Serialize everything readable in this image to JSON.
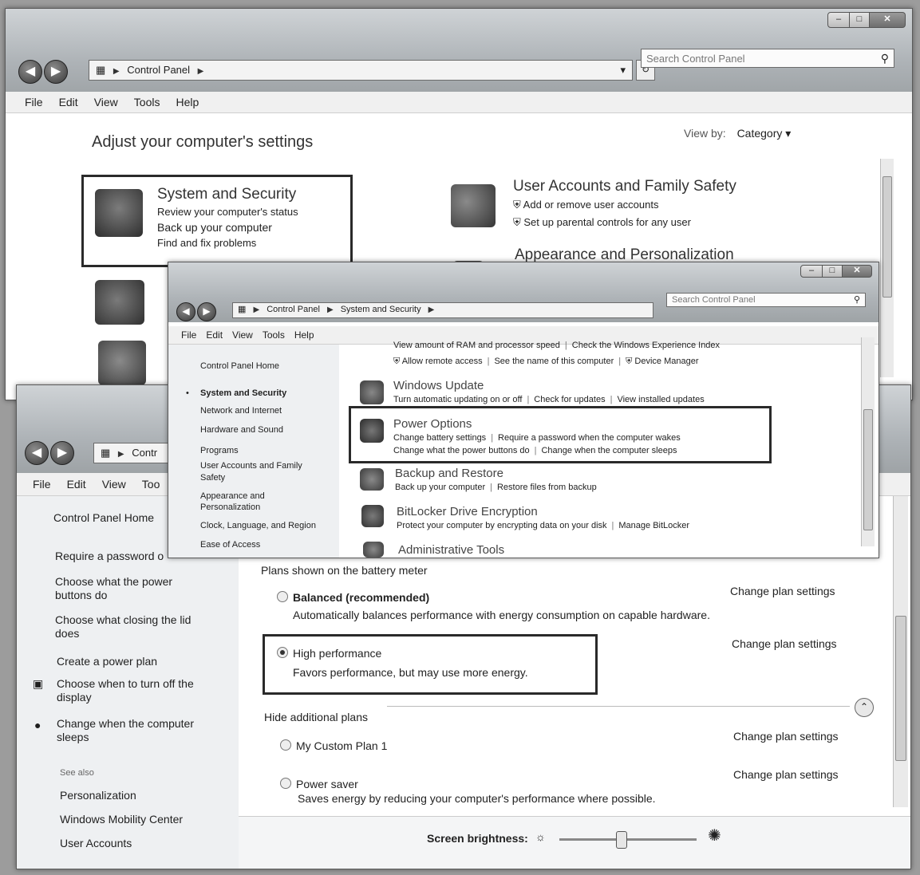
{
  "main_window": {
    "address": [
      "Control Panel"
    ],
    "search_placeholder": "Search Control Panel",
    "menu": [
      "File",
      "Edit",
      "View",
      "Tools",
      "Help"
    ],
    "heading": "Adjust your computer's settings",
    "view_by_label": "View by:",
    "view_by_value": "Category",
    "categories": [
      {
        "title": "System and Security",
        "links": [
          "Review your computer's status",
          "Back up your computer",
          "Find and fix problems"
        ]
      },
      {
        "title": "User Accounts and Family Safety",
        "links": [
          "Add or remove user accounts",
          "Set up parental controls for any user"
        ]
      },
      {
        "title": "Appearance and Personalization",
        "links": []
      }
    ]
  },
  "power_window": {
    "address_fragment": "Contr",
    "menu": [
      "File",
      "Edit",
      "View",
      "Too"
    ],
    "left_nav": {
      "home": "Control Panel Home",
      "items": [
        "Require a password o",
        "Choose what the power buttons do",
        "Choose what closing the lid does",
        "Create a power plan",
        "Choose when to turn off the display",
        "Change when the computer sleeps"
      ],
      "see_also_title": "See also",
      "see_also": [
        "Personalization",
        "Windows Mobility Center",
        "User Accounts"
      ]
    },
    "section_label": "Plans shown on the battery meter",
    "plans": [
      {
        "name": "Balanced (recommended)",
        "desc": "Automatically balances performance with energy consumption on capable hardware.",
        "action": "Change plan settings",
        "selected": false
      },
      {
        "name": "High performance",
        "desc": "Favors performance, but may use more energy.",
        "action": "Change plan settings",
        "selected": true
      }
    ],
    "hide_label": "Hide additional plans",
    "extra_plans": [
      {
        "name": "My Custom Plan 1",
        "desc": "",
        "action": "Change plan settings",
        "selected": false
      },
      {
        "name": "Power saver",
        "desc": "Saves energy by reducing your computer's performance where possible.",
        "action": "Change plan settings",
        "selected": false
      }
    ],
    "brightness_label": "Screen brightness:",
    "brightness_level": 0.45
  },
  "security_window": {
    "address": [
      "Control Panel",
      "System and Security"
    ],
    "search_placeholder": "Search Control Panel",
    "menu": [
      "File",
      "Edit",
      "View",
      "Tools",
      "Help"
    ],
    "left_nav": [
      "Control Panel Home",
      "System and Security",
      "Network and Internet",
      "Hardware and Sound",
      "Programs",
      "User Accounts and Family Safety",
      "Appearance and Personalization",
      "Clock, Language, and Region",
      "Ease of Access"
    ],
    "active_nav": 1,
    "system_links_row1": [
      "View amount of RAM and processor speed",
      "Check the Windows Experience Index"
    ],
    "system_links_row2": [
      "Allow remote access",
      "See the name of this computer",
      "Device Manager"
    ],
    "items": [
      {
        "title": "Windows Update",
        "links": [
          "Turn automatic updating on or off",
          "Check for updates",
          "View installed updates"
        ]
      },
      {
        "title": "Power Options",
        "links": [
          "Change battery settings",
          "Require a password when the computer wakes",
          "Change what the power buttons do",
          "Change when the computer sleeps"
        ]
      },
      {
        "title": "Backup and Restore",
        "links": [
          "Back up your computer",
          "Restore files from backup"
        ]
      },
      {
        "title": "BitLocker Drive Encryption",
        "links": [
          "Protect your computer by encrypting data on your disk",
          "Manage BitLocker"
        ]
      },
      {
        "title": "Administrative Tools",
        "links": []
      }
    ]
  }
}
